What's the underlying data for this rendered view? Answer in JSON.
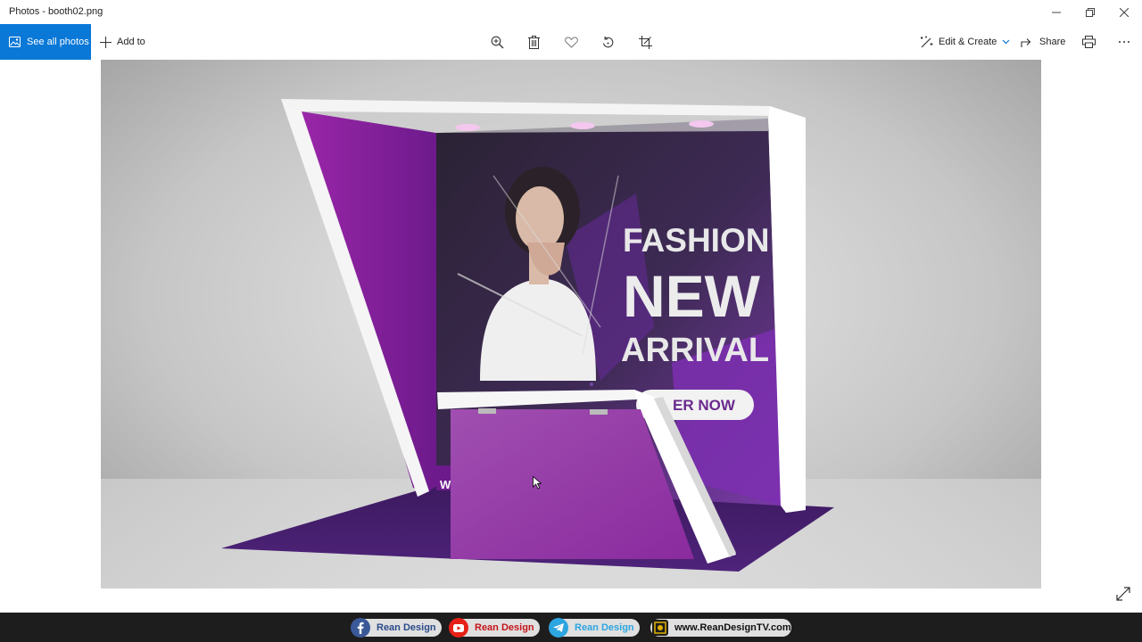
{
  "window": {
    "title": "Photos - booth02.png"
  },
  "toolbar": {
    "see_all_label": "See all photos",
    "add_to_label": "Add to",
    "edit_create_label": "Edit & Create",
    "share_label": "Share"
  },
  "booth_graphic": {
    "headline_1": "FASHION",
    "headline_2": "NEW",
    "headline_3": "ARRIVAL",
    "button_text": "ER NOW",
    "bottom_text": "W"
  },
  "social_bar": {
    "facebook": "Rean Design",
    "youtube": "Rean Design",
    "telegram": "Rean Design",
    "website": "www.ReanDesignTV.com"
  },
  "colors": {
    "accent": "#0a78d7",
    "booth_purple": "#8a2aa0",
    "floor_purple": "#4a2078",
    "bar_bg": "#1d1d1d",
    "facebook": "#3b5998",
    "youtube": "#e62117",
    "telegram": "#2ca5e0"
  }
}
